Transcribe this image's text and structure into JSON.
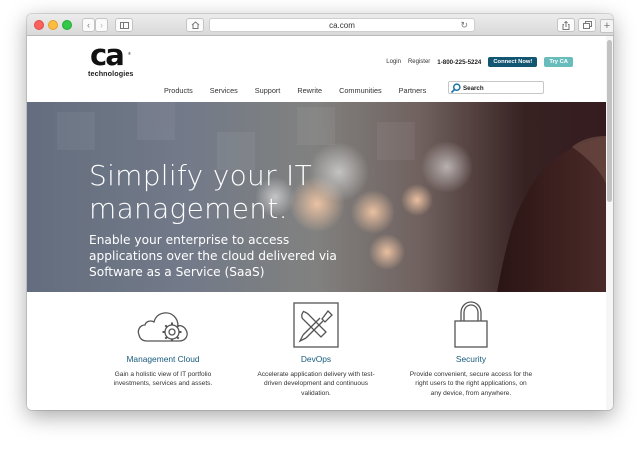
{
  "browser": {
    "url": "ca.com"
  },
  "logo": {
    "mark": "ca",
    "reg": "®",
    "tagline": "technologies"
  },
  "utility": {
    "login": "Login",
    "register": "Register",
    "phone": "1-800-225-5224",
    "connect": "Connect Now!",
    "try": "Try CA"
  },
  "nav": {
    "items": [
      "Products",
      "Services",
      "Support",
      "Rewrite",
      "Communities",
      "Partners"
    ],
    "search_label": "Search"
  },
  "hero": {
    "title_line1": "Simplify your IT",
    "title_line2": "management.",
    "sub_line1": "Enable your enterprise to access",
    "sub_line2": "applications over the cloud delivered via",
    "sub_line3": "Software as a Service (SaaS)"
  },
  "features": [
    {
      "icon": "cloud-gear-icon",
      "title": "Management Cloud",
      "desc_line1": "Gain a holistic view of IT portfolio",
      "desc_line2": "investments, services and assets."
    },
    {
      "icon": "wrench-screwdriver-icon",
      "title": "DevOps",
      "desc_line1": "Accelerate application delivery with test-",
      "desc_line2": "driven development and continuous",
      "desc_line3": "validation."
    },
    {
      "icon": "padlock-icon",
      "title": "Security",
      "desc_line1": "Provide convenient, secure access for the",
      "desc_line2": "right users to the right applications, on",
      "desc_line3": "any device, from anywhere."
    }
  ],
  "colors": {
    "brand_blue": "#135672",
    "accent_teal": "#69bcbc",
    "link_blue": "#175b7d"
  }
}
